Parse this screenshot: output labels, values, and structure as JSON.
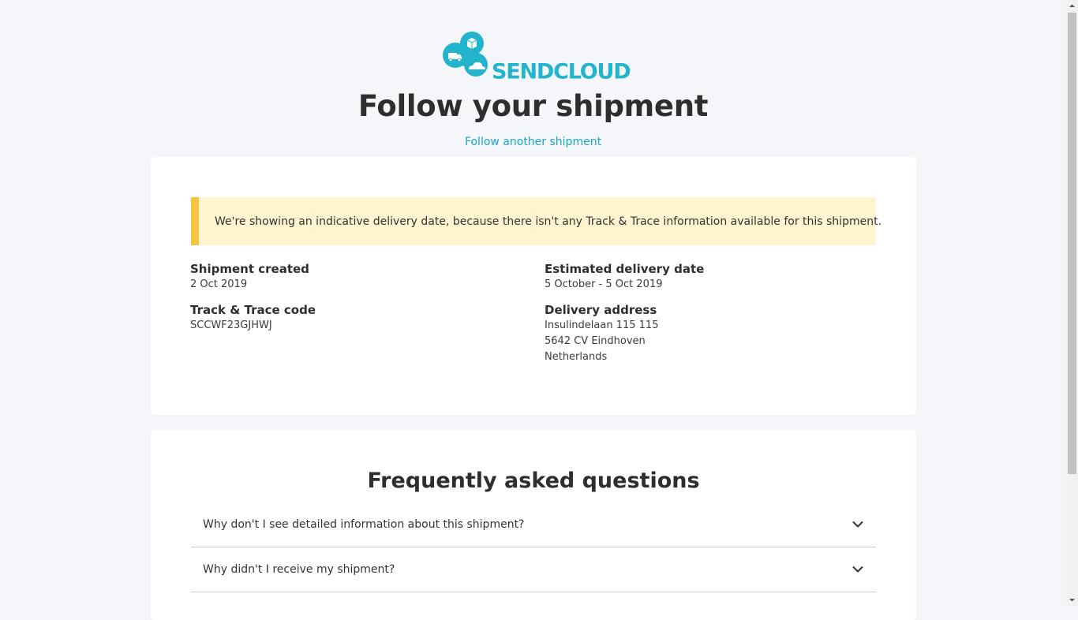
{
  "brand": {
    "name": "SENDCLOUD",
    "color": "#22b4cc",
    "logo_icon": "sendcloud-cloud-icon"
  },
  "header": {
    "title": "Follow your shipment",
    "follow_another_link": "Follow another shipment"
  },
  "notice": {
    "text": "We're showing an indicative delivery date, because there isn't any Track & Trace information available for this shipment.",
    "accent_color": "#f4c542",
    "background_color": "#fff4cf"
  },
  "shipment": {
    "created_label": "Shipment created",
    "created_value": "2 Oct 2019",
    "tracking_label": "Track & Trace code",
    "tracking_value": "SCCWF23GJHWJ",
    "estimated_label": "Estimated delivery date",
    "estimated_value": "5 October - 5 Oct 2019",
    "address_label": "Delivery address",
    "address_lines": [
      "Insulindelaan 115 115",
      "5642 CV Eindhoven",
      "Netherlands"
    ]
  },
  "faq": {
    "title": "Frequently asked questions",
    "items": [
      {
        "question": "Why don't I see detailed information about this shipment?",
        "icon": "chevron-down-icon"
      },
      {
        "question": "Why didn't I receive my shipment?",
        "icon": "chevron-down-icon"
      }
    ]
  }
}
